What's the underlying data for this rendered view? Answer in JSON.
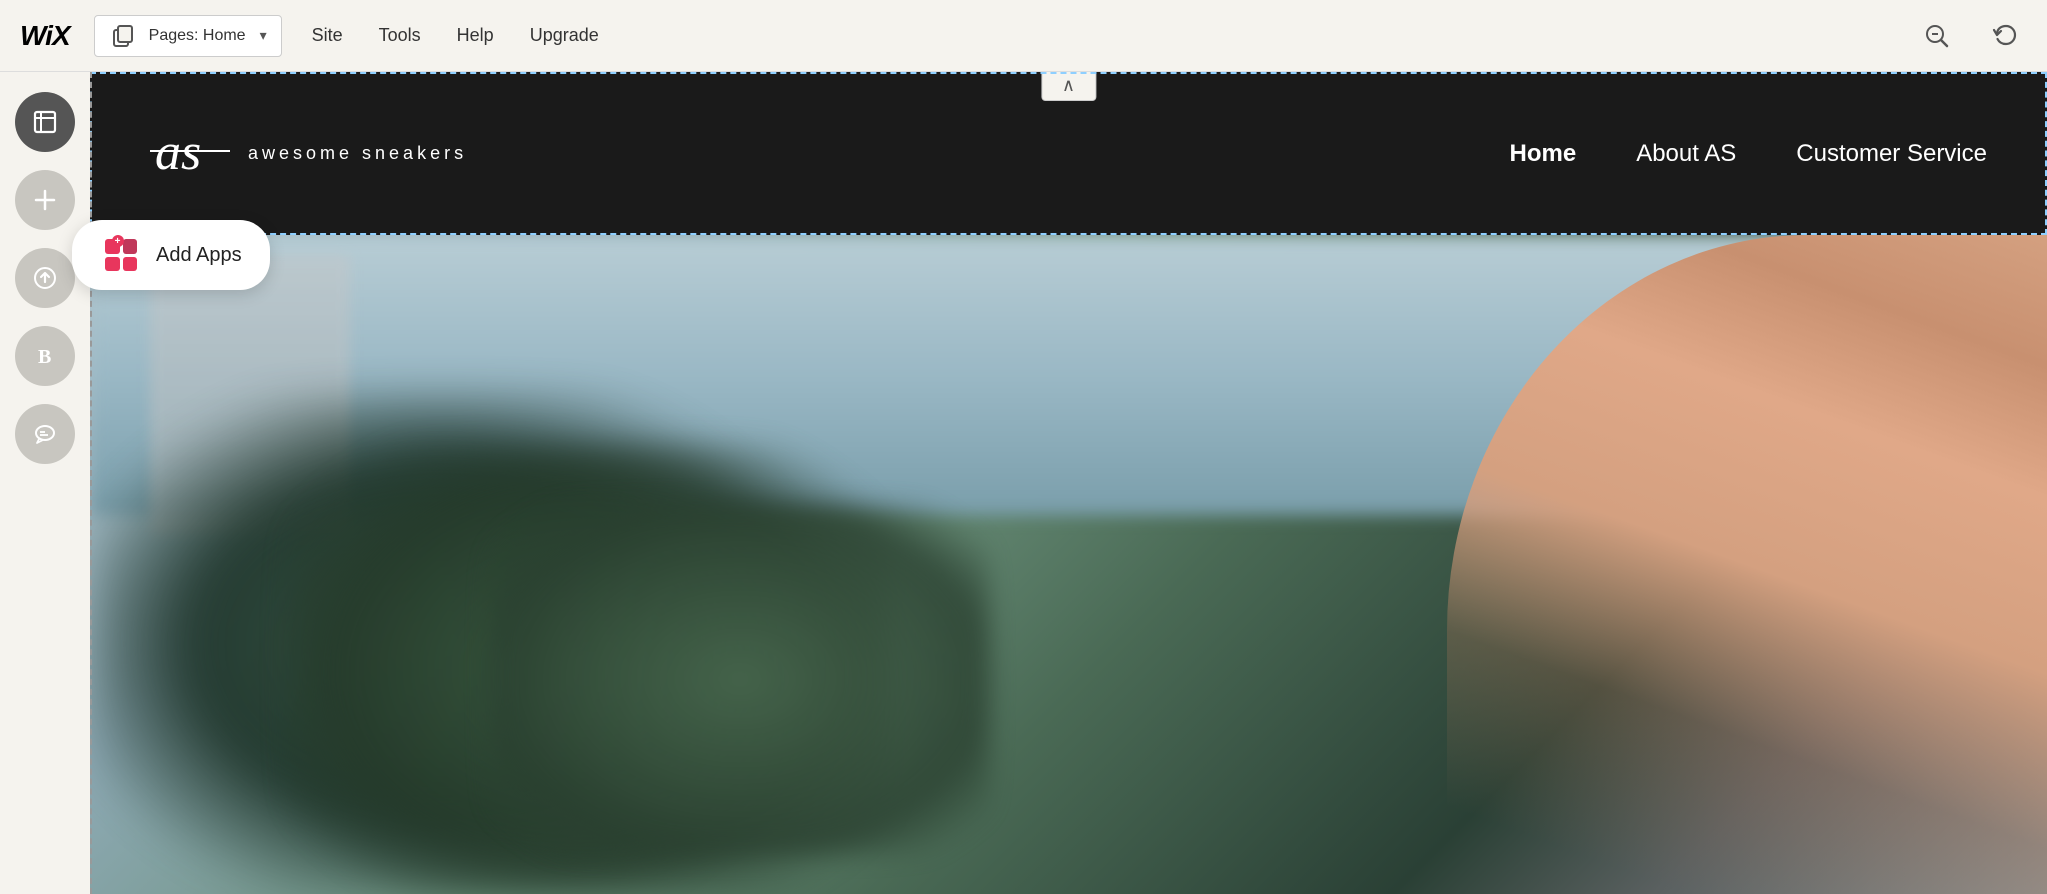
{
  "toolbar": {
    "wix_logo": "WiX",
    "pages_label": "Pages: Home",
    "site_label": "Site",
    "tools_label": "Tools",
    "help_label": "Help",
    "upgrade_label": "Upgrade",
    "zoom_out_icon": "zoom-out",
    "undo_icon": "undo"
  },
  "sidebar": {
    "btn_pages": "pages",
    "btn_add": "add",
    "btn_upload": "upload",
    "btn_blog": "blog",
    "btn_chat": "chat",
    "add_apps_label": "Add Apps"
  },
  "site": {
    "logo_symbol": "as",
    "logo_text": "awesome sneakers",
    "nav_home": "Home",
    "nav_about": "About AS",
    "nav_customer_service": "Customer Service"
  },
  "tooltip": {
    "add_apps_label": "Add Apps"
  }
}
